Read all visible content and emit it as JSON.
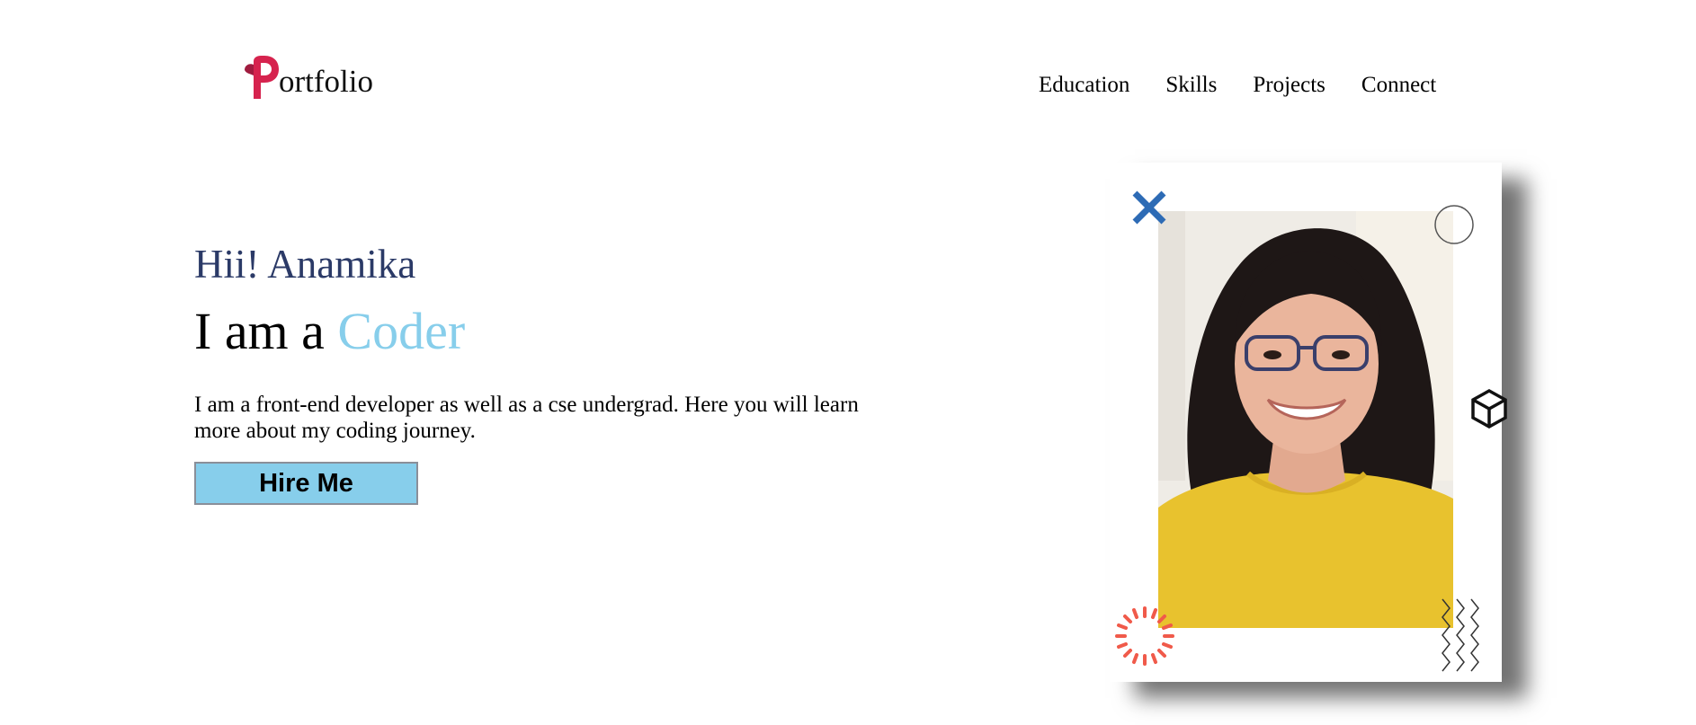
{
  "header": {
    "logo": {
      "initial": "P",
      "rest": "ortfolio",
      "brand_color": "#d6234e"
    },
    "nav": [
      {
        "label": "Education"
      },
      {
        "label": "Skills"
      },
      {
        "label": "Projects"
      },
      {
        "label": "Connect"
      }
    ]
  },
  "hero": {
    "greeting": "Hii! Anamika",
    "role_prefix": "I am a ",
    "role_highlight": "Coder",
    "description": "I am a front-end developer as well as a cse undergrad. Here you will learn more about my coding journey.",
    "cta_label": "Hire Me"
  },
  "colors": {
    "greeting": "#2b3a67",
    "accent": "#87ceeb",
    "button_bg": "#87ceeb",
    "cross_icon": "#2d6bb5",
    "sunburst_icon": "#f05a4a"
  },
  "icons": [
    "cross-icon",
    "circle-outline-icon",
    "cube-icon",
    "sunburst-icon",
    "zigzag-icon"
  ]
}
